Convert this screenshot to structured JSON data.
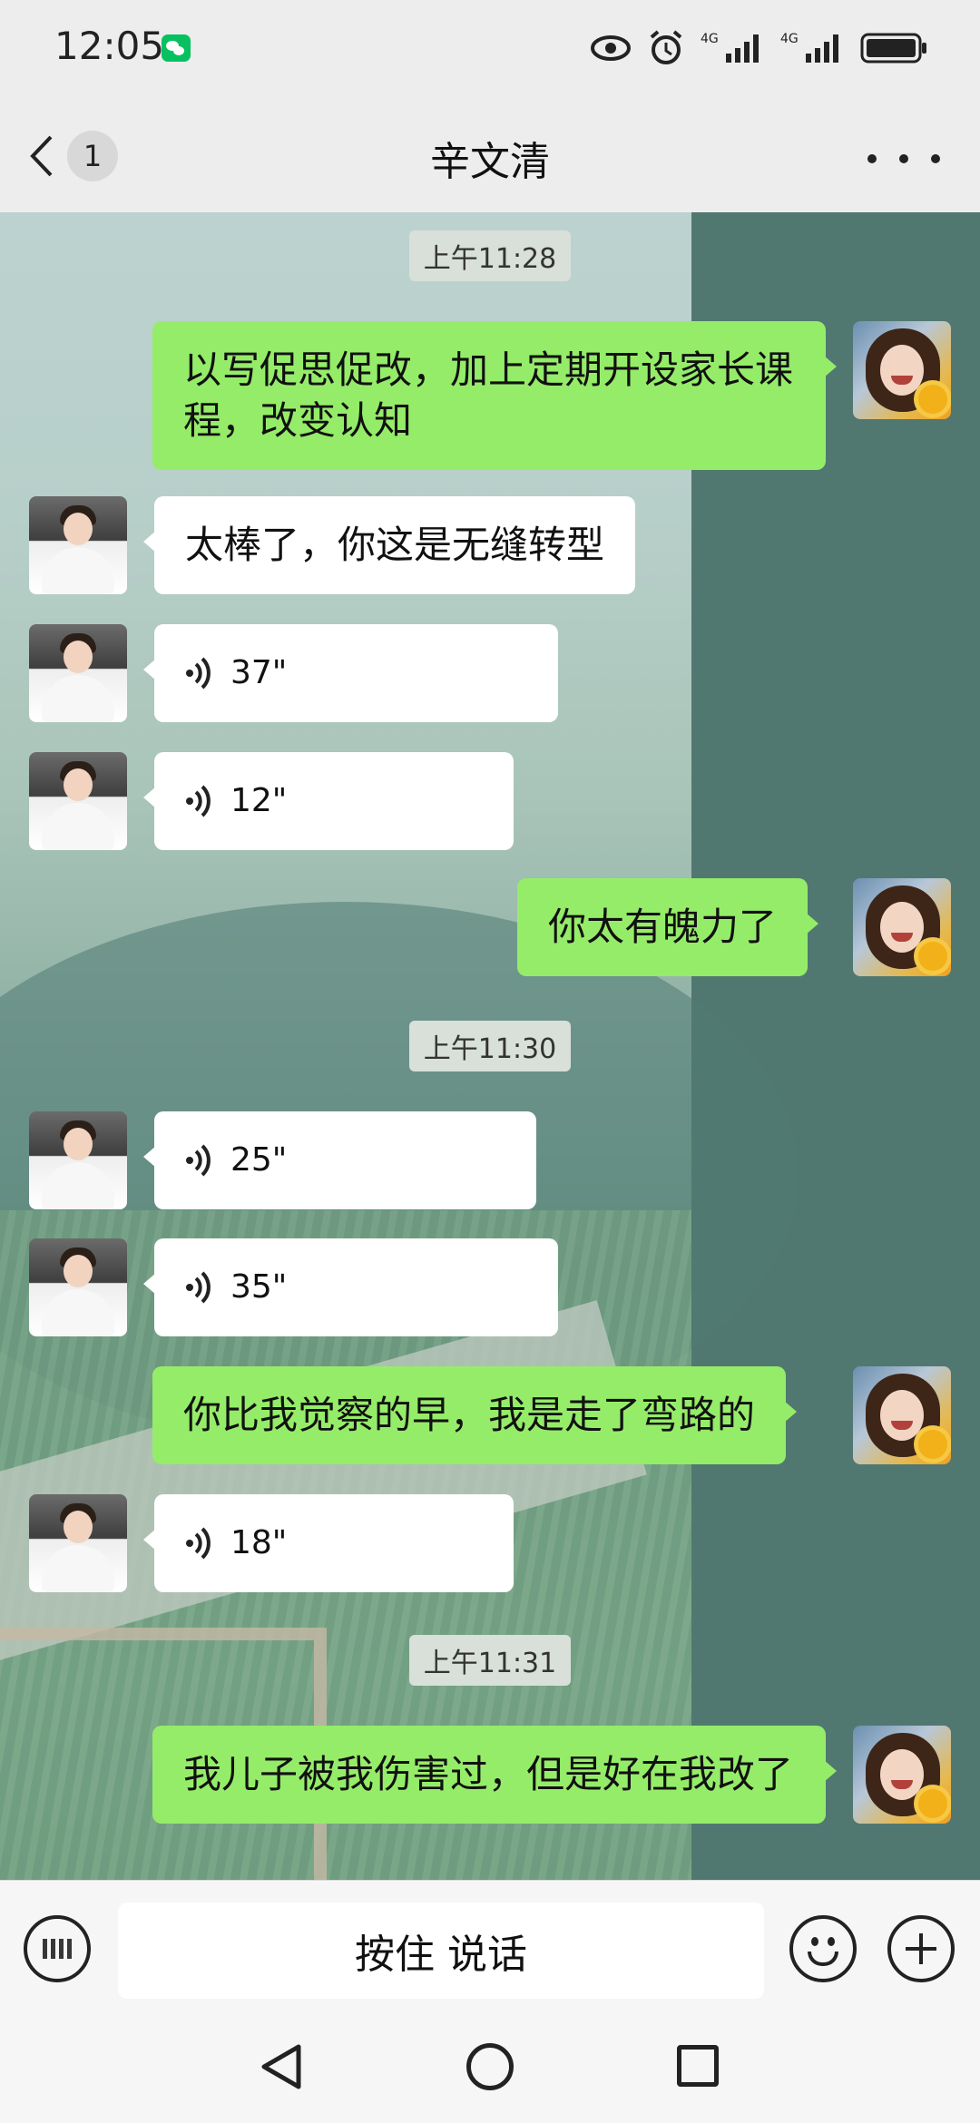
{
  "status_bar": {
    "time": "12:05"
  },
  "nav": {
    "unread_count": "1",
    "title": "辛文清"
  },
  "messages": {
    "ts1": "上午11:28",
    "m1": "以写促思促改，加上定期开设家长课程，改变认知",
    "m2": "太棒了，你这是无缝转型",
    "m3": "37\"",
    "m4": "12\"",
    "m5": "你太有魄力了",
    "ts2": "上午11:30",
    "m6": "25\"",
    "m7": "35\"",
    "m8": "你比我觉察的早，我是走了弯路的",
    "m9": "18\"",
    "ts3": "上午11:31",
    "m10": "我儿子被我伤害过，但是好在我改了"
  },
  "input_bar": {
    "hold_to_talk": "按住 说话"
  },
  "colors": {
    "outgoing_bubble": "#95ec69",
    "incoming_bubble": "#ffffff",
    "background": "#ededed"
  },
  "icons": [
    "eye-icon",
    "alarm-icon",
    "signal-4g-icon",
    "battery-icon",
    "back-chevron-icon",
    "more-dots-icon",
    "voice-wave-icon",
    "keyboard-icon",
    "emoji-icon",
    "plus-icon",
    "nav-back-icon",
    "nav-home-icon",
    "nav-recent-icon"
  ]
}
